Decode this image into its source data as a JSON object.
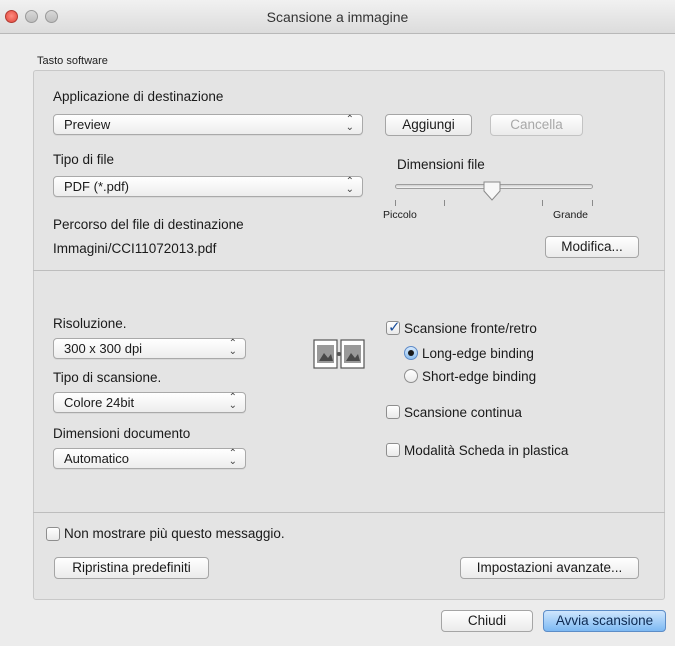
{
  "window": {
    "title": "Scansione a immagine"
  },
  "group": {
    "label": "Tasto software"
  },
  "app": {
    "label": "Applicazione di destinazione",
    "value": "Preview",
    "add_button": "Aggiungi",
    "delete_button": "Cancella"
  },
  "file_type": {
    "label": "Tipo di file",
    "value": "PDF (*.pdf)"
  },
  "file_size": {
    "label": "Dimensioni file",
    "min_label": "Piccolo",
    "max_label": "Grande",
    "level": 0.5
  },
  "path": {
    "label": "Percorso del file di destinazione",
    "value": "Immagini/CCI11072013.pdf",
    "modify_button": "Modifica..."
  },
  "resolution": {
    "label": "Risoluzione.",
    "value": "300 x 300 dpi"
  },
  "scan_type": {
    "label": "Tipo di scansione.",
    "value": "Colore 24bit"
  },
  "doc_size": {
    "label": "Dimensioni documento",
    "value": "Automatico"
  },
  "options": {
    "duplex": {
      "label": "Scansione fronte/retro",
      "checked": true
    },
    "long_edge": {
      "label": "Long-edge binding",
      "selected": true
    },
    "short_edge": {
      "label": "Short-edge binding",
      "selected": false
    },
    "continuous": {
      "label": "Scansione continua",
      "checked": false
    },
    "plastic_card": {
      "label": "Modalità Scheda in plastica",
      "checked": false
    }
  },
  "dont_show": {
    "label": "Non mostrare più questo messaggio.",
    "checked": false
  },
  "restore_button": "Ripristina predefiniti",
  "advanced_button": "Impostazioni avanzate...",
  "close_button": "Chiudi",
  "start_button": "Avvia scansione",
  "icons": {
    "popup_arrows": "⌃⌄",
    "check": "✓"
  }
}
